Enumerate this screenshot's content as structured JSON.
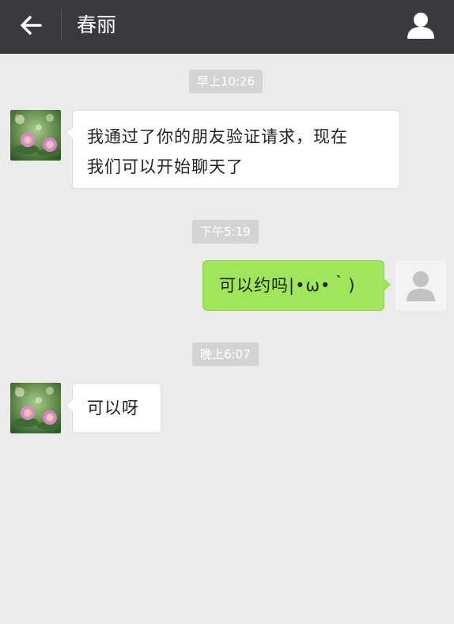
{
  "header": {
    "title": "春丽",
    "back_icon": "back-arrow-icon",
    "profile_icon": "person-icon"
  },
  "messages": [
    {
      "time": "早上10:26",
      "side": "left",
      "text_line1": "我通过了你的朋友验证请求，现在",
      "text_line2": "我们可以开始聊天了"
    },
    {
      "time": "下午5:19",
      "side": "right",
      "text": "可以约吗|•ω•｀)"
    },
    {
      "time": "晚上6:07",
      "side": "left",
      "text": "可以呀"
    }
  ],
  "colors": {
    "header_bg": "#3a3a3e",
    "chat_bg": "#ebebeb",
    "sent_bubble": "#9fe65a",
    "received_bubble": "#ffffff",
    "timestamp_bg": "#d4d4d4"
  }
}
